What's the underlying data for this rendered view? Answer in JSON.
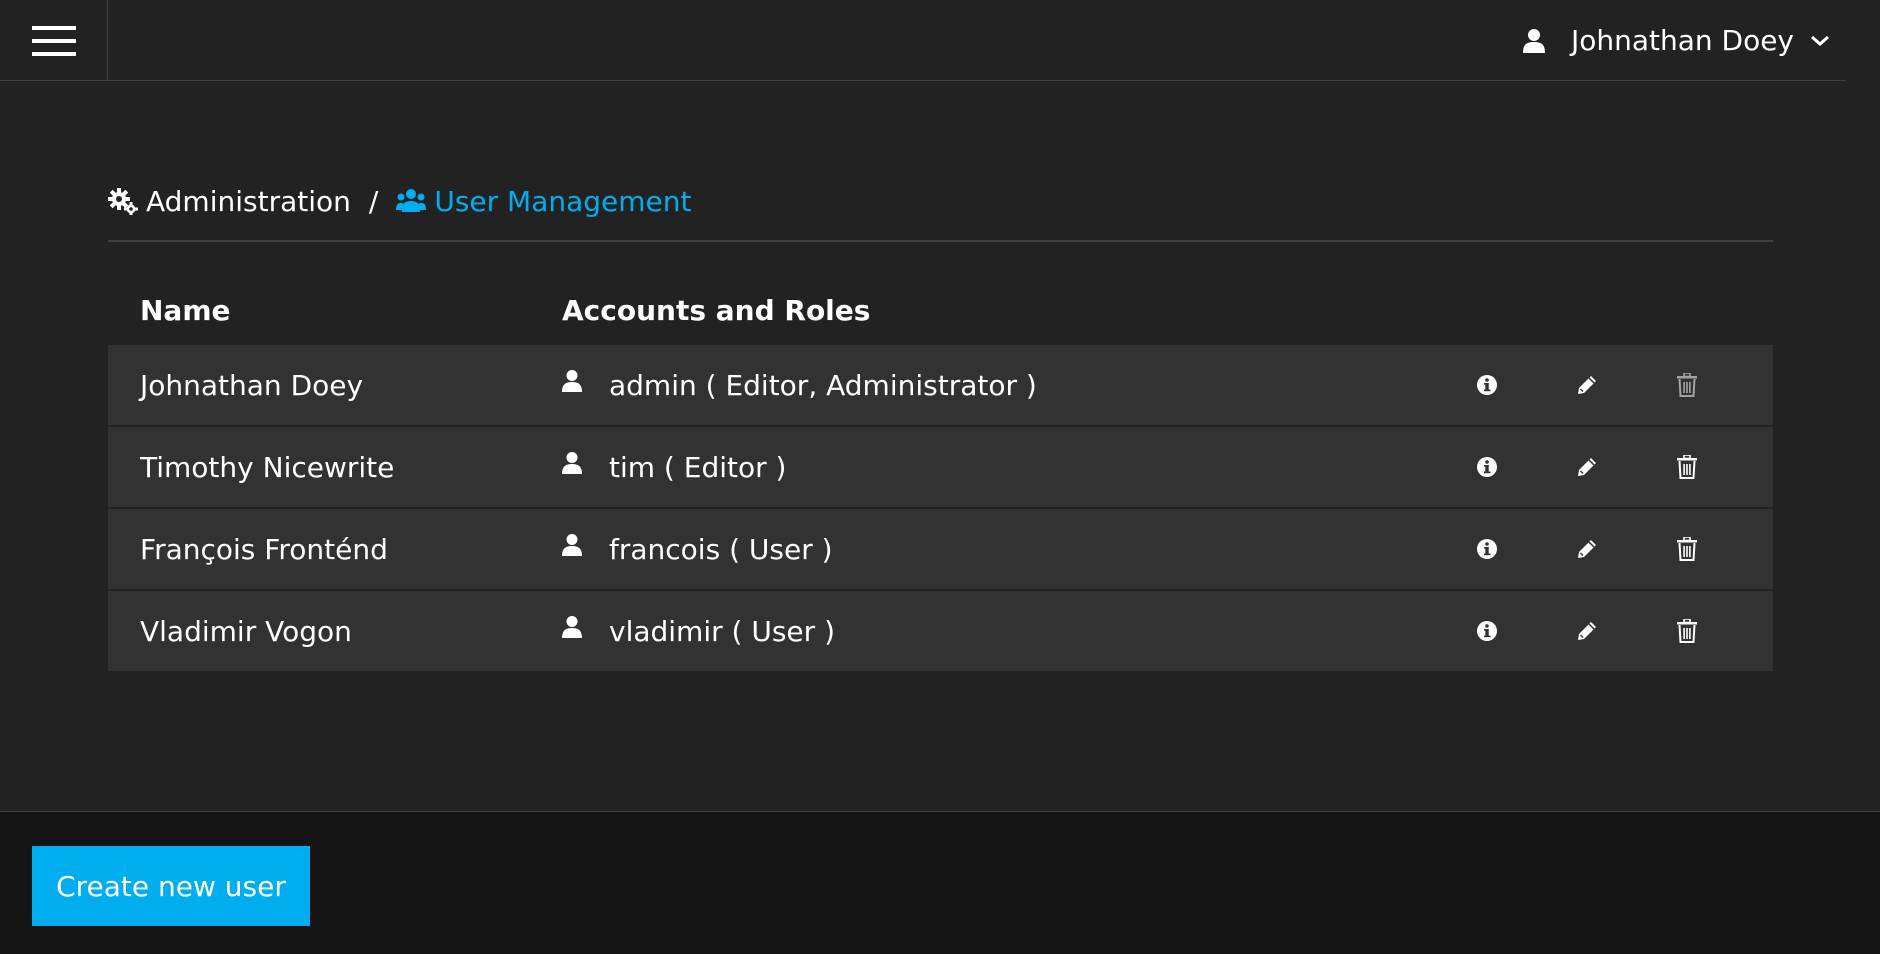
{
  "header": {
    "menu_icon": "hamburger-icon",
    "user_icon": "user-icon",
    "user_name": "Johnathan Doey",
    "chevron_icon": "chevron-down-icon"
  },
  "breadcrumb": {
    "root_icon": "gears-icon",
    "root_label": "Administration",
    "separator": "/",
    "current_icon": "users-icon",
    "current_label": "User Management"
  },
  "table": {
    "columns": [
      "Name",
      "Accounts and Roles"
    ],
    "rows": [
      {
        "name": "Johnathan Doey",
        "account": "admin ( Editor, Administrator )",
        "delete_disabled": true
      },
      {
        "name": "Timothy Nicewrite",
        "account": "tim ( Editor )",
        "delete_disabled": false
      },
      {
        "name": "François Fronténd",
        "account": "francois ( User )",
        "delete_disabled": false
      },
      {
        "name": "Vladimir Vogon",
        "account": "vladimir ( User )",
        "delete_disabled": false
      }
    ],
    "action_icons": [
      "info-icon",
      "pencil-icon",
      "trash-icon"
    ]
  },
  "footer": {
    "create_label": "Create new user"
  },
  "colors": {
    "accent": "#00adee",
    "background": "#222222",
    "row": "#323232",
    "footer": "#141414"
  }
}
